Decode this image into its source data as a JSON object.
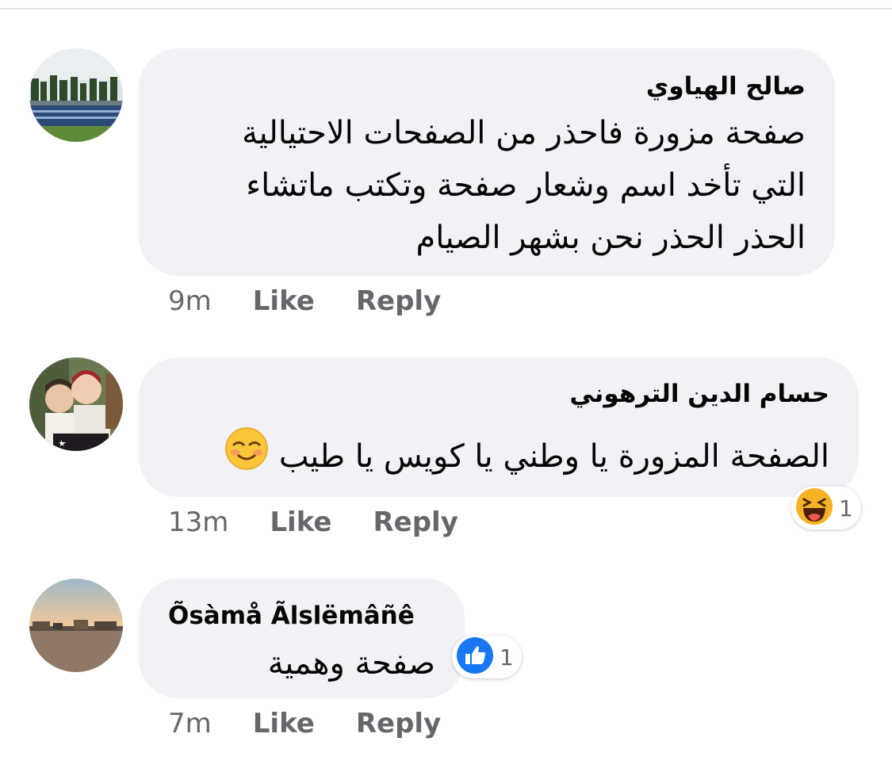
{
  "comments": [
    {
      "author": "صالح الهياوي",
      "lines": [
        "صفحة مزورة فاحذر من الصفحات الاحتيالية",
        "التي تأخد اسم وشعار صفحة وتكتب ماتشاء",
        "الحذر الحذر نحن بشهر الصيام"
      ],
      "time": "9m",
      "like_label": "Like",
      "reply_label": "Reply"
    },
    {
      "author": "حسام الدين الترهوني",
      "lines": [
        "الصفحة المزورة يا وطني يا كويس يا طيب"
      ],
      "emoji": "smiling-blush-emoji",
      "time": "13m",
      "like_label": "Like",
      "reply_label": "Reply",
      "reaction": {
        "type": "haha",
        "count": "1"
      }
    },
    {
      "author": "Õsàmå Ãlslëmâñê",
      "lines": [
        "صفحة وهمية"
      ],
      "time": "7m",
      "like_label": "Like",
      "reply_label": "Reply",
      "reaction": {
        "type": "like",
        "count": "1"
      }
    }
  ],
  "colors": {
    "bubble": "#f0f2f5",
    "meta_text": "#65676b",
    "like_blue": "#1877f2",
    "haha_yellow": "#f7b125"
  }
}
